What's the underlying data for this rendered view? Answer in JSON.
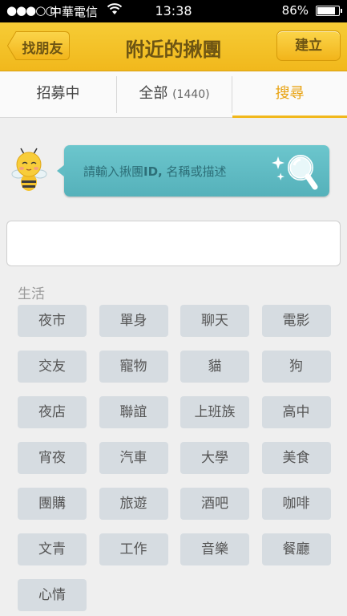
{
  "status_bar": {
    "signal": "●●●○○",
    "carrier": "中華電信",
    "time": "13:38",
    "battery_pct": "86%",
    "battery_level": 0.86,
    "icons": [
      "wifi-icon",
      "battery-icon"
    ]
  },
  "nav": {
    "back_label": "找朋友",
    "title": "附近的揪團",
    "create_label": "建立",
    "colors": {
      "bar": "#f1b81c",
      "text": "#6e5513"
    }
  },
  "tabs": [
    {
      "label": "招募中",
      "count": "",
      "active": false
    },
    {
      "label": "全部",
      "count": "(1440)",
      "active": false
    },
    {
      "label": "搜尋",
      "count": "",
      "active": true
    }
  ],
  "hint": {
    "text_prefix": "請輸入揪團",
    "text_bold": "ID,",
    "text_suffix": " 名稱或描述",
    "icons": [
      "bee-mascot-icon",
      "magnifier-icon"
    ]
  },
  "search": {
    "value": "",
    "placeholder": ""
  },
  "category": {
    "label": "生活",
    "tags": [
      "夜市",
      "單身",
      "聊天",
      "電影",
      "交友",
      "寵物",
      "貓",
      "狗",
      "夜店",
      "聯誼",
      "上班族",
      "高中",
      "宵夜",
      "汽車",
      "大學",
      "美食",
      "團購",
      "旅遊",
      "酒吧",
      "咖啡",
      "文青",
      "工作",
      "音樂",
      "餐廳",
      "心情"
    ]
  },
  "accent_color": "#f1b81c",
  "tag_color": "#d6dce1"
}
